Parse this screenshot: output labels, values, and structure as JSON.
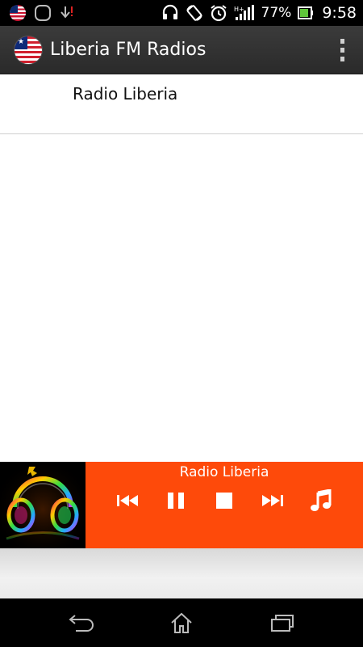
{
  "status_bar": {
    "battery_percent": "77%",
    "time": "9:58",
    "icons": [
      "liberia-flag-icon",
      "app-notification-icon",
      "download-icon",
      "headset-icon",
      "rotate-icon",
      "alarm-icon",
      "signal-icon",
      "battery-icon"
    ]
  },
  "action_bar": {
    "title": "Liberia FM Radios",
    "icon": "liberia-flag-icon",
    "overflow_icon": "overflow-menu-icon"
  },
  "stations": [
    {
      "label": "Radio Liberia"
    }
  ],
  "player": {
    "now_playing": "Radio Liberia",
    "controls": [
      "previous-icon",
      "pause-icon",
      "stop-icon",
      "next-icon",
      "music-note-icon"
    ],
    "accent_color": "#fe4a0a"
  },
  "nav_bar": {
    "buttons": [
      "back-icon",
      "home-icon",
      "recent-apps-icon"
    ]
  }
}
